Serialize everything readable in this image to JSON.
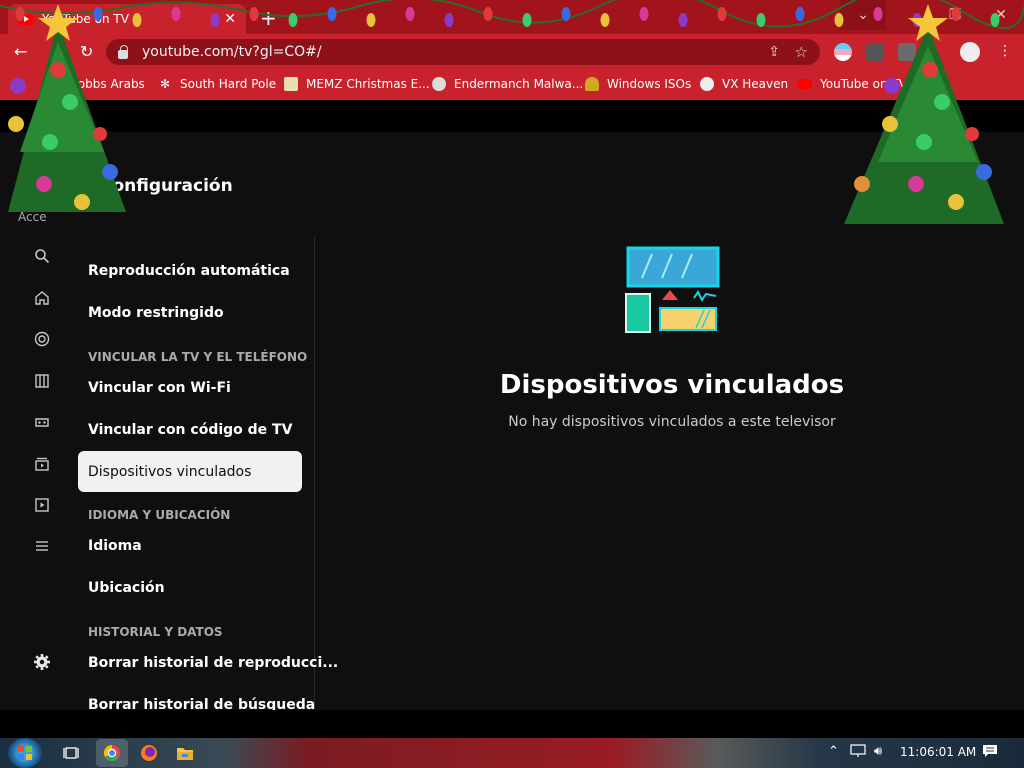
{
  "browser": {
    "tab_title": "YouTube on TV",
    "url": "youtube.com/tv?gl=CO#/",
    "new_tab_symbol": "+",
    "close_tab_symbol": "✕",
    "window_controls": [
      "⌄",
      "❐",
      "✕"
    ],
    "bookmarks": [
      {
        "label": "Robbs Arabs",
        "icon": "world-icon",
        "color": "#2a5fd0"
      },
      {
        "label": "South Hard Pole",
        "icon": "flower-icon",
        "color": "#ffffff"
      },
      {
        "label": "MEMZ Christmas E...",
        "icon": "image-icon",
        "color": "#e8e0b0"
      },
      {
        "label": "Endermanch Malwa...",
        "icon": "cat-icon",
        "color": "#dddddd"
      },
      {
        "label": "Windows ISOs",
        "icon": "figure-icon",
        "color": "#e0c020"
      },
      {
        "label": "VX Heaven",
        "icon": "skull-icon",
        "color": "#eeeeee"
      },
      {
        "label": "YouTube on TV",
        "icon": "youtube-icon",
        "color": "#ff0000"
      }
    ]
  },
  "app": {
    "header_title": "Configuración",
    "access_text": "Acce",
    "menu": [
      {
        "type": "item",
        "label": "Reproducción automática"
      },
      {
        "type": "item",
        "label": "Modo restringido"
      },
      {
        "type": "section",
        "label": "VINCULAR LA TV Y EL TELÉFONO"
      },
      {
        "type": "item",
        "label": "Vincular con Wi-Fi"
      },
      {
        "type": "item",
        "label": "Vincular con código de TV"
      },
      {
        "type": "selected",
        "label": "Dispositivos vinculados"
      },
      {
        "type": "section",
        "label": "IDIOMA Y UBICACIÓN"
      },
      {
        "type": "item",
        "label": "Idioma"
      },
      {
        "type": "item",
        "label": "Ubicación"
      },
      {
        "type": "section",
        "label": "HISTORIAL Y DATOS"
      },
      {
        "type": "item",
        "label": "Borrar historial de reproducci..."
      },
      {
        "type": "item",
        "label": "Borrar historial de búsqueda"
      }
    ],
    "main_title": "Dispositivos vinculados",
    "main_subtitle": "No hay dispositivos vinculados a este televisor"
  },
  "taskbar": {
    "clock": "11:06:01 AM"
  }
}
